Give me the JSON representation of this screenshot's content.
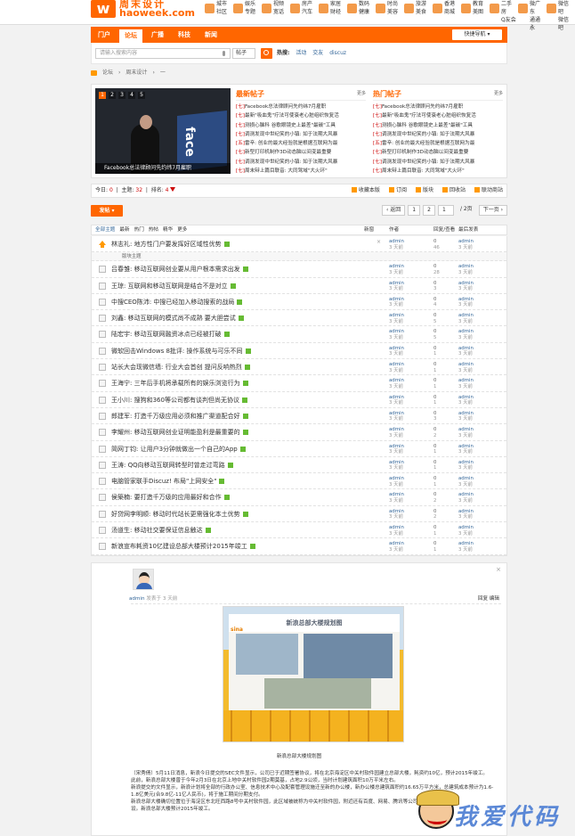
{
  "brand": {
    "cn": "周末设计",
    "domain": "haoweek.com",
    "mark": "w"
  },
  "channels": [
    {
      "col": [
        "城市",
        "社区"
      ],
      "hl": false
    },
    {
      "col": [
        "娱乐",
        "专题"
      ],
      "hl": false
    },
    {
      "col": [
        "视频",
        "宽话"
      ],
      "hl": false
    },
    {
      "col": [
        "房产",
        "汽车"
      ],
      "hl": false
    },
    {
      "col": [
        "家居",
        "财经"
      ],
      "hl": false
    },
    {
      "col": [
        "数码",
        "健康"
      ],
      "hl": false
    },
    {
      "col": [
        "时尚",
        "美容"
      ],
      "hl": false
    },
    {
      "col": [
        "旅游",
        "美食"
      ],
      "hl": false
    },
    {
      "col": [
        "香港",
        "商城"
      ],
      "hl": false
    },
    {
      "col": [
        "教育",
        "美图"
      ],
      "hl": false
    },
    {
      "col": [
        "二手房",
        "Q友会"
      ],
      "hl": false
    },
    {
      "col": [
        "微广东",
        "通通永"
      ],
      "hl": false
    },
    {
      "col": [
        "微信吧",
        "微信吧"
      ],
      "hl": false
    }
  ],
  "nav": {
    "items": [
      "门户",
      "论坛",
      "广播",
      "科技",
      "新闻"
    ],
    "active": 1,
    "quick": "快捷导航 ▾"
  },
  "search": {
    "placeholder": "请输入搜索内容",
    "scope": "帖子",
    "hot_label": "热搜:",
    "hot": [
      "活动",
      "交友",
      "discuz"
    ]
  },
  "breadcrumb": [
    "论坛",
    "周末设计",
    "一"
  ],
  "slider": {
    "nums": [
      "1",
      "2",
      "3",
      "4",
      "5"
    ],
    "caption": "Facebook总法律顾问先约纬7月雇职",
    "screen_text": "face"
  },
  "latest": {
    "title": "最新帖子",
    "more": "更多",
    "items": [
      "Facebook总法律顾问先约纬7月雇职",
      "最新\"吸血鬼\"疗法可使衰老心脏组织恢复活",
      "测损心脑科 谷歌眼镜史上最差\"最碳\"工具",
      "调测发现中世纪笑的小镇: 如于法期大风暴",
      "雷辛: 创业的最大经验就是根据互联网为最",
      "新型打印机制作3D动态脑以间变最重要",
      "调测发现中世纪笑的小镇: 如于法期大风暴",
      "周末辩上篇目联音: 大同驾域\"大火环\""
    ],
    "tags": [
      "[七]",
      "[七]",
      "[七]",
      "[七]",
      "[五]",
      "[七]",
      "[七]",
      "[七]"
    ]
  },
  "hottest": {
    "title": "热门帖子",
    "more": "更多",
    "items": [
      "Facebook总法律顾问先约纬7月雇职",
      "最新\"吸血鬼\"疗法可使衰老心脏组织恢复活",
      "测损心脑科 谷歌眼镜史上最差\"最碳\"工具",
      "调测发现中世纪笑的小镇: 如于法期大风暴",
      "雷辛: 创业的最大经验就是根据互联网为最",
      "新型打印机制作3D动态脑以间变最重要",
      "调测发现中世纪笑的小镇: 如于法期大风暴",
      "周末辩上篇目联音: 大同驾域\"大火环\""
    ],
    "tags": [
      "[七]",
      "[七]",
      "[七]",
      "[七]",
      "[五]",
      "[七]",
      "[七]",
      "[七]"
    ]
  },
  "stats": {
    "today_label": "今日:",
    "today": "0",
    "topics_label": "主题:",
    "topics": "32",
    "rank_label": "排名:",
    "rank": "4",
    "actions": [
      "收藏本版",
      "订阅",
      "版块",
      "回收站",
      "联动商站"
    ]
  },
  "pager": {
    "post": "发帖 ▾",
    "prev": "‹ 返回",
    "p1": "1",
    "p2": "2",
    "input": "1",
    "total": "/ 2页",
    "next": "下一页 ›"
  },
  "list_header": {
    "tabs": [
      "全部主题",
      "最新",
      "热门",
      "热帖",
      "精华",
      "更多"
    ],
    "new": "新窗",
    "author": "作者",
    "replies": "回复/查看",
    "last": "最后发表"
  },
  "sticky": {
    "title": "林志礼: 地方性门户要发挥好区域性优势",
    "author": "admin",
    "time": "3 天前",
    "replies": "0",
    "views": "46",
    "last": "admin",
    "last_time": "3 天前"
  },
  "sep_label": "版块主题",
  "threads": [
    {
      "title": "吕春雏: 移动互联网创业要从用户根本需求出发",
      "r": "0",
      "v": "28"
    },
    {
      "title": "王琼: 互联网和移动互联网是结合不是对立",
      "r": "0",
      "v": "3"
    },
    {
      "title": "中搜CEO陈沛: 中搜已经加入移动搜索的战局",
      "r": "0",
      "v": "4"
    },
    {
      "title": "刘鑫: 移动互联网的模式尚不成熟 要大胆尝试",
      "r": "0",
      "v": "5"
    },
    {
      "title": "陆宏宇: 移动互联网融资冰点已经被打破",
      "r": "0",
      "v": "5"
    },
    {
      "title": "微软回击Windows 8批评: 操作系统与可乐不同",
      "r": "0",
      "v": "1"
    },
    {
      "title": "站长大会现微信墙: 行业大会首创 提问反响热烈",
      "r": "0",
      "v": "1"
    },
    {
      "title": "王海宁: 三年后手机将承载所有的娱乐浏览行为",
      "r": "0",
      "v": "1"
    },
    {
      "title": "王小川: 搜狗和360等公司都有谈判但尚无协议",
      "r": "0",
      "v": "1"
    },
    {
      "title": "郎建军: 打造千万级应用必须和推广渠道配合好",
      "r": "0",
      "v": "3"
    },
    {
      "title": "李耀州: 移动互联网创业证明能盈利是最重要的",
      "r": "0",
      "v": "2"
    },
    {
      "title": "简网丁钧: 让用户3分钟就做出一个自己的App",
      "r": "0",
      "v": "1"
    },
    {
      "title": "王涛: QQ向移动互联网转型时曾走过弯路",
      "r": "0",
      "v": "1"
    },
    {
      "title": "电脑管家联手Discuz! 布局\"上网安全\"",
      "r": "0",
      "v": "1"
    },
    {
      "title": "侯築楠: 要打造千万级的应用最好和合作",
      "r": "0",
      "v": "2"
    },
    {
      "title": "好贷网李明顺: 移动时代站长更需强化本土优势",
      "r": "0",
      "v": "2"
    },
    {
      "title": "汤道生: 移动社交要保证信息触达",
      "r": "0",
      "v": "1"
    },
    {
      "title": "新浪宣布耗资10亿建设总部大楼预计2015年竣工",
      "r": "0",
      "v": "1"
    }
  ],
  "thread_author": "admin",
  "thread_time": "3 天前",
  "preview": {
    "close": "×",
    "meta_user": "admin",
    "meta_text": "发表于 3 天前",
    "actions": "回复 编辑",
    "board_title": "新浪总部大楼规划图",
    "board_logo": "sina",
    "caption": "新浪总部大楼规划图",
    "paragraphs": [
      "（宋秀倩）5月11日消息，新浪今日提交的SEC文件显示，公司已于近期签署协议，将在北京海淀区中关村软件园建立总部大楼，耗资约10亿，预计2015年竣工。",
      "此前，新浪总部大楼曾于今年2月3日在北京上地中关村软件园2期莫基，占地2.9公顷，当时计划建筑面积10万平米左右。",
      "新浪提交的文件显示，新浪计划将全部的行政办公室、信息技术中心及配套管理设施迁至新的办公楼，新办公楼总建筑面积约16.65万平方米，总建筑成本预计为1.6-1.8亿美元(合9.8亿-11亿人民币)，将于施工期间分期支付。",
      "新浪总部大楼确切位置位于海淀区东北旺西路8号中关村软件园，此区域被统称为中关村软件园，附近还有百度、网易、腾讯等公司。",
      "设。新浪总部大楼预计2015年竣工。"
    ]
  },
  "watermark": "我爱代码"
}
